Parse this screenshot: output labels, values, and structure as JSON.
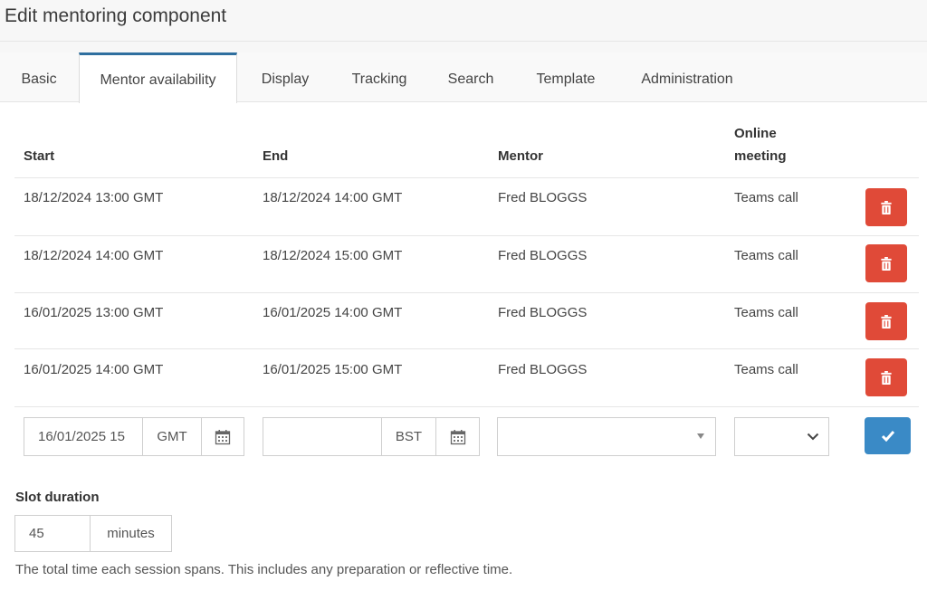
{
  "page": {
    "title": "Edit mentoring component"
  },
  "tabs": [
    {
      "label": "Basic"
    },
    {
      "label": "Mentor availability"
    },
    {
      "label": "Display"
    },
    {
      "label": "Tracking"
    },
    {
      "label": "Search"
    },
    {
      "label": "Template"
    },
    {
      "label": "Administration"
    }
  ],
  "active_tab": "Mentor availability",
  "table": {
    "headers": {
      "start": "Start",
      "end": "End",
      "mentor": "Mentor",
      "online_1": "Online",
      "online_2": "meeting"
    },
    "rows": [
      {
        "start": "18/12/2024 13:00 GMT",
        "end": "18/12/2024 14:00 GMT",
        "mentor": "Fred BLOGGS",
        "meeting": "Teams call"
      },
      {
        "start": "18/12/2024 14:00 GMT",
        "end": "18/12/2024 15:00 GMT",
        "mentor": "Fred BLOGGS",
        "meeting": "Teams call"
      },
      {
        "start": "16/01/2025 13:00 GMT",
        "end": "16/01/2025 14:00 GMT",
        "mentor": "Fred BLOGGS",
        "meeting": "Teams call"
      },
      {
        "start": "16/01/2025 14:00 GMT",
        "end": "16/01/2025 15:00 GMT",
        "mentor": "Fred BLOGGS",
        "meeting": "Teams call"
      }
    ]
  },
  "new_row": {
    "start_value": "16/01/2025 15",
    "start_tz": "GMT",
    "end_value": "",
    "end_tz": "BST",
    "mentor_value": "",
    "meeting_value": ""
  },
  "slot": {
    "label": "Slot duration",
    "value": "45",
    "unit": "minutes",
    "help": "The total time each session spans. This includes any preparation or reflective time."
  },
  "icons": {
    "delete": "trash-icon",
    "calendar": "calendar-icon",
    "confirm": "check-icon",
    "dropdown": "chevron-down-icon"
  },
  "colors": {
    "delete_button": "#e04a38",
    "confirm_button": "#3a8ac6",
    "active_tab_accent": "#2f6f9f"
  }
}
